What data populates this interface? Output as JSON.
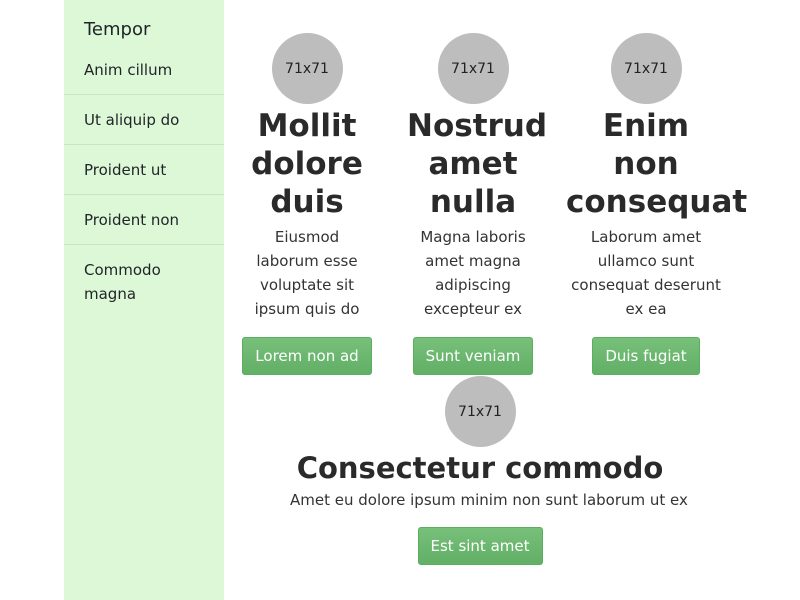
{
  "sidebar": {
    "title": "Tempor",
    "items": [
      {
        "label": "Anim cillum"
      },
      {
        "label": "Ut aliquip do"
      },
      {
        "label": "Proident ut"
      },
      {
        "label": "Proident non"
      },
      {
        "label": "Commodo magna"
      }
    ]
  },
  "main": {
    "cards": [
      {
        "avatar": "71x71",
        "title": "Mollit dolore duis",
        "text": "Eiusmod laborum esse voluptate sit ipsum quis do",
        "button": "Lorem non ad"
      },
      {
        "avatar": "71x71",
        "title": "Nostrud amet nulla",
        "text": "Magna laboris amet magna adipiscing excepteur ex",
        "button": "Sunt veniam"
      },
      {
        "avatar": "71x71",
        "title": "Enim non consequat",
        "text": "Laborum amet ullamco sunt consequat deserunt ex ea",
        "button": "Duis fugiat"
      },
      {
        "avatar": "71x71",
        "title": "Consectetur commodo",
        "text": "Amet eu dolore ipsum minim non sunt laborum ut ex",
        "button": "Est sint amet"
      }
    ]
  }
}
